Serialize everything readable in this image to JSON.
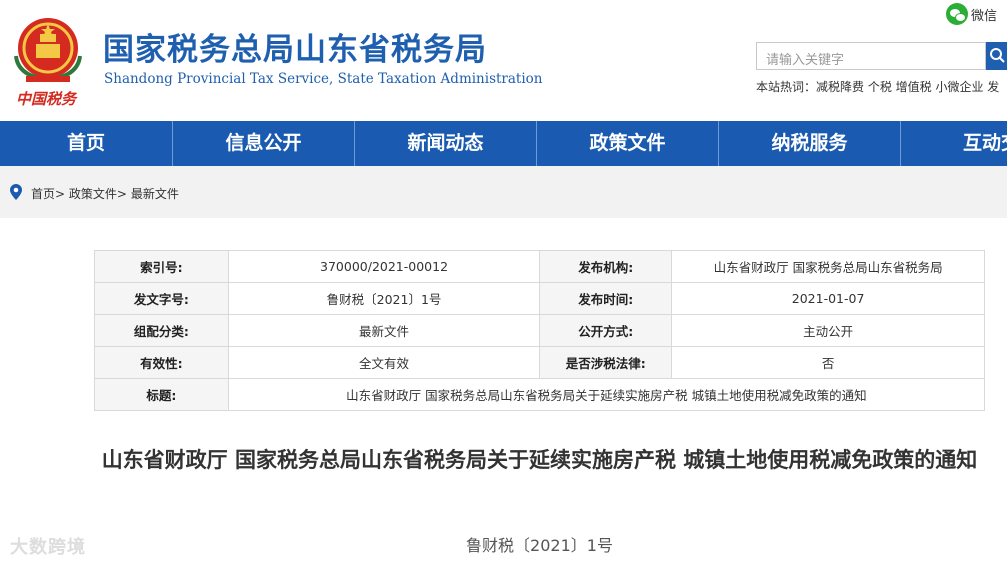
{
  "header": {
    "title": "国家税务总局山东省税务局",
    "subtitle": "Shandong Provincial Tax Service, State Taxation Administration",
    "logo_text": "中国税务",
    "wechat_label": "微信",
    "search_placeholder": "请输入关键字",
    "hot_words": "本站热词：减税降费 个税 增值税 小微企业 发"
  },
  "nav": {
    "items": [
      "首页",
      "信息公开",
      "新闻动态",
      "政策文件",
      "纳税服务",
      "互动交"
    ]
  },
  "breadcrumb": {
    "items": [
      "首页",
      "政策文件",
      "最新文件"
    ],
    "separator": ">"
  },
  "meta": {
    "index_no_label": "索引号:",
    "index_no": "370000/2021-00012",
    "publisher_label": "发布机构:",
    "publisher": "山东省财政厅 国家税务总局山东省税务局",
    "doc_no_label": "发文字号:",
    "doc_no": "鲁财税〔2021〕1号",
    "date_label": "发布时间:",
    "date": "2021-01-07",
    "category_label": "组配分类:",
    "category": "最新文件",
    "open_label": "公开方式:",
    "open": "主动公开",
    "validity_label": "有效性:",
    "validity": "全文有效",
    "tax_law_label": "是否涉税法律:",
    "tax_law": "否",
    "subject_label": "标题:",
    "subject": "山东省财政厅 国家税务总局山东省税务局关于延续实施房产税 城镇土地使用税减免政策的通知"
  },
  "article": {
    "title": "山东省财政厅 国家税务总局山东省税务局关于延续实施房产税 城镇土地使用税减免政策的通知",
    "doc_no": "鲁财税〔2021〕1号"
  },
  "watermark": "大数跨境",
  "colors": {
    "brand_blue": "#1a5ab0",
    "emblem_red": "#d42a20",
    "wechat_green": "#2bae34"
  }
}
